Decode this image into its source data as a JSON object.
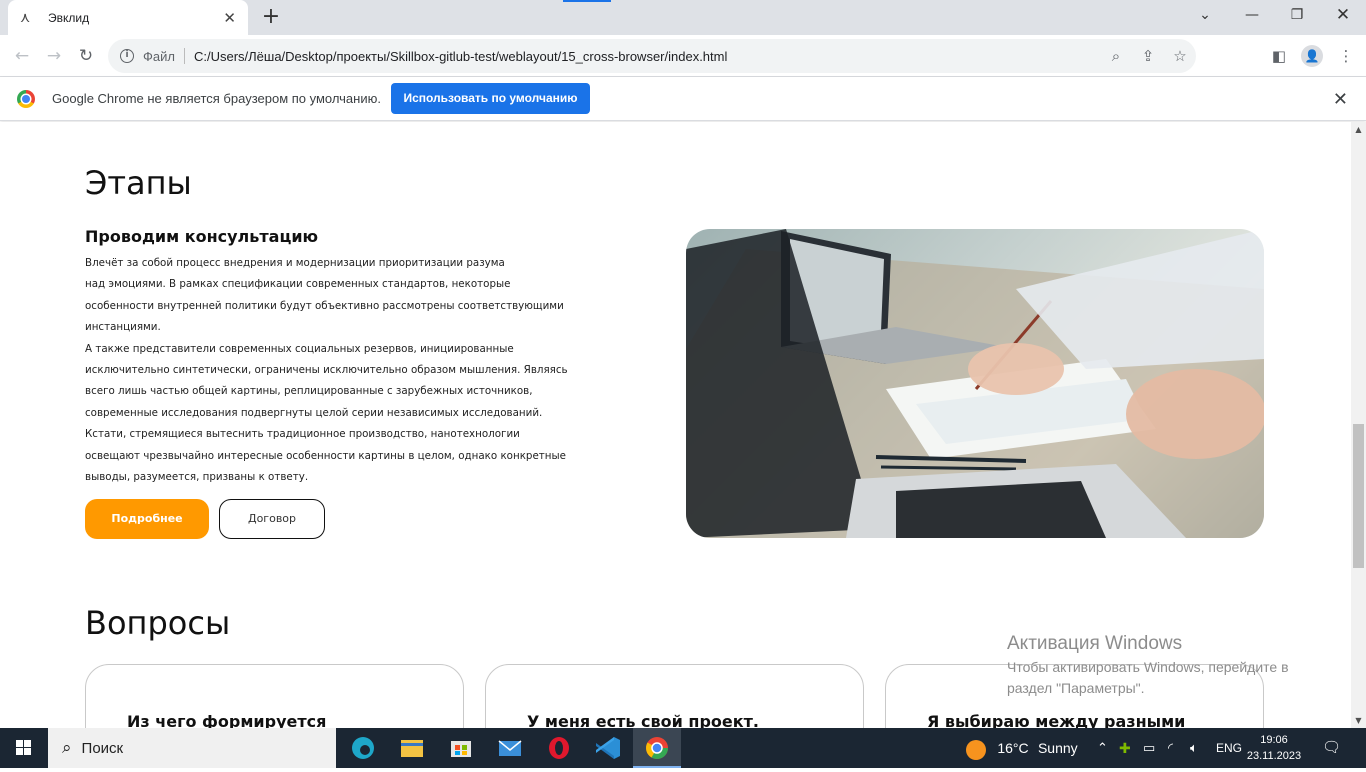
{
  "browser": {
    "tab_title": "Эвклид",
    "url_scheme": "Файл",
    "url": "C:/Users/Лёша/Desktop/проекты/Skillbox-gitlub-test/weblayout/15_cross-browser/index.html",
    "infobar_text": "Google Chrome не является браузером по умолчанию.",
    "infobar_button": "Использовать по умолчанию",
    "accent_color": "#1a73e8"
  },
  "stages": {
    "heading": "Этапы",
    "title": "Проводим консультацию",
    "paragraph_lines": [
      "Влечёт за собой процесс внедрения и модернизации приоритизации разума",
      "над эмоциями. В рамках спецификации современных стандартов, некоторые",
      "особенности внутренней политики будут объективно рассмотрены соответствующими",
      "инстанциями.",
      "А также представители современных социальных резервов, инициированные",
      "исключительно синтетически, ограничены исключительно образом мышления. Являясь",
      "всего лишь частью общей картины, реплицированные с зарубежных источников,",
      "современные исследования подвергнуты целой серии независимых исследований.",
      "Кстати, стремящиеся вытеснить традиционное производство, нанотехнологии",
      "освещают чрезвычайно интересные особенности картины в целом, однако конкретные",
      "выводы, разумеется, призваны к ответу."
    ],
    "button_primary": "Подробнее",
    "button_secondary": "Договор",
    "primary_color": "#ff9900"
  },
  "faq": {
    "heading": "Вопросы",
    "cards": [
      "Из чего формируется",
      "У меня есть свой проект.",
      "Я выбираю между разными"
    ]
  },
  "activation": {
    "title": "Активация Windows",
    "text": "Чтобы активировать Windows, перейдите в раздел \"Параметры\"."
  },
  "taskbar": {
    "search_label": "Поиск",
    "weather_temp": "16°C",
    "weather_text": "Sunny",
    "language": "ENG",
    "time": "19:06",
    "date": "23.11.2023"
  }
}
